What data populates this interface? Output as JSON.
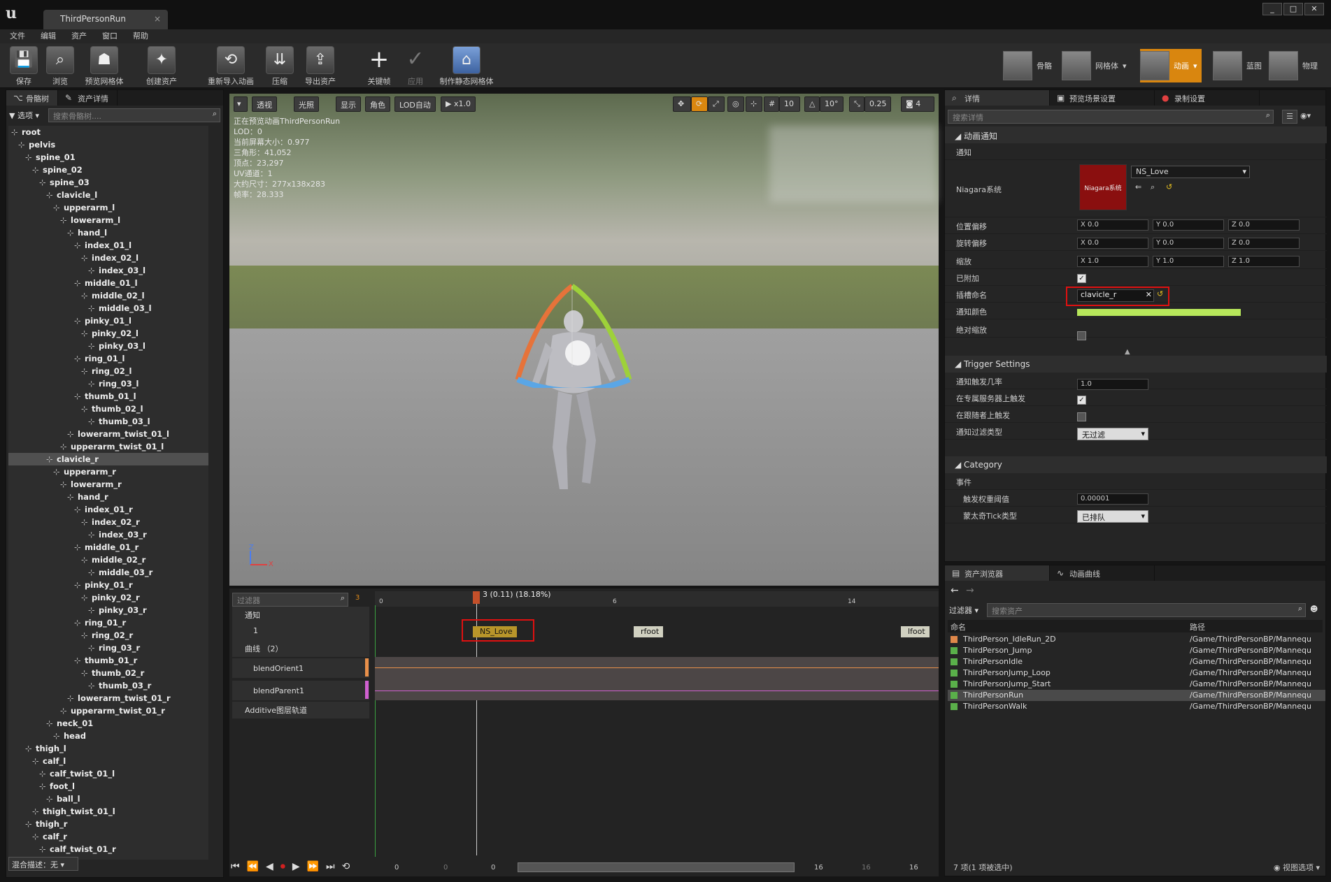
{
  "window": {
    "tab_title": "ThirdPersonRun",
    "buttons": [
      "_",
      "□",
      "✕"
    ]
  },
  "menu": [
    "文件",
    "编辑",
    "资产",
    "窗口",
    "帮助"
  ],
  "toolbar": {
    "items": [
      "保存",
      "浏览",
      "预览网格体",
      "创建资产",
      "重新导入动画",
      "压缩",
      "导出资产",
      "关键帧",
      "应用",
      "制作静态网格体"
    ],
    "modes": [
      "骨骼",
      "网格体",
      "动画",
      "蓝图",
      "物理"
    ],
    "active_mode": "动画"
  },
  "skeleton_panel": {
    "tabs": [
      "骨骼树",
      "资产详情"
    ],
    "options_label": "选项",
    "search_placeholder": "搜索骨骼树....",
    "bones": [
      "root",
      "pelvis",
      "spine_01",
      "spine_02",
      "spine_03",
      "clavicle_l",
      "upperarm_l",
      "lowerarm_l",
      "hand_l",
      "index_01_l",
      "index_02_l",
      "index_03_l",
      "middle_01_l",
      "middle_02_l",
      "middle_03_l",
      "pinky_01_l",
      "pinky_02_l",
      "pinky_03_l",
      "ring_01_l",
      "ring_02_l",
      "ring_03_l",
      "thumb_01_l",
      "thumb_02_l",
      "thumb_03_l",
      "lowerarm_twist_01_l",
      "upperarm_twist_01_l",
      "clavicle_r",
      "upperarm_r",
      "lowerarm_r",
      "hand_r",
      "index_01_r",
      "index_02_r",
      "index_03_r",
      "middle_01_r",
      "middle_02_r",
      "middle_03_r",
      "pinky_01_r",
      "pinky_02_r",
      "pinky_03_r",
      "ring_01_r",
      "ring_02_r",
      "ring_03_r",
      "thumb_01_r",
      "thumb_02_r",
      "thumb_03_r",
      "lowerarm_twist_01_r",
      "upperarm_twist_01_r",
      "neck_01",
      "head",
      "thigh_l",
      "calf_l",
      "calf_twist_01_l",
      "foot_l",
      "ball_l",
      "thigh_twist_01_l",
      "thigh_r",
      "calf_r",
      "calf_twist_01_r"
    ],
    "indent": [
      0,
      1,
      2,
      3,
      4,
      5,
      6,
      7,
      8,
      9,
      10,
      11,
      9,
      10,
      11,
      9,
      10,
      11,
      9,
      10,
      11,
      9,
      10,
      11,
      8,
      7,
      5,
      6,
      7,
      8,
      9,
      10,
      11,
      9,
      10,
      11,
      9,
      10,
      11,
      9,
      10,
      11,
      9,
      10,
      11,
      8,
      7,
      5,
      6,
      2,
      3,
      4,
      4,
      5,
      3,
      2,
      3,
      4
    ],
    "selected": "clavicle_r",
    "footer": "混合描述：无"
  },
  "viewport": {
    "buttons": [
      "透视",
      "光照",
      "显示",
      "角色",
      "LOD自动",
      "x1.0"
    ],
    "right_buttons": [
      "10",
      "10°",
      "0.25",
      "4"
    ],
    "info": [
      "正在预览动画ThirdPersonRun",
      "LOD：0",
      "当前屏幕大小：0.977",
      "三角形：41,052",
      "顶点：23,297",
      "UV通道：1",
      "大约尺寸：277x138x283",
      "帧率：28.333"
    ],
    "axis_z": "Z",
    "axis_x": "X"
  },
  "details": {
    "tabs": [
      "详情",
      "预览场景设置",
      "录制设置"
    ],
    "search_placeholder": "搜索详情",
    "sec_notify": "动画通知",
    "notify_label": "通知",
    "niagara_label": "Niagara系统",
    "niagara_thumb": "Niagara系统",
    "niagara_value": "NS_Love",
    "pos_label": "位置偏移",
    "rot_label": "旋转偏移",
    "scale_label": "缩放",
    "pos": [
      "X",
      "0.0",
      "Y",
      "0.0",
      "Z",
      "0.0"
    ],
    "rot": [
      "X",
      "0.0",
      "Y",
      "0.0",
      "Z",
      "0.0"
    ],
    "scale": [
      "X",
      "1.0",
      "Y",
      "1.0",
      "Z",
      "1.0"
    ],
    "attached_label": "已附加",
    "socket_label": "插槽命名",
    "socket_value": "clavicle_r",
    "color_label": "通知颜色",
    "color_value": "#b6e65a",
    "abs_scale_label": "绝对缩放",
    "sec_trigger": "Trigger Settings",
    "chance_label": "通知触发几率",
    "chance_value": "1.0",
    "dedicated_label": "在专属服务器上触发",
    "follower_label": "在跟随者上触发",
    "filter_label": "通知过滤类型",
    "filter_value": "无过滤",
    "sec_category": "Category",
    "event_label": "事件",
    "weight_label": "触发权重阈值",
    "weight_value": "0.00001",
    "montage_label": "蒙太奇Tick类型",
    "montage_value": "已排队"
  },
  "assets": {
    "tabs": [
      "资产浏览器",
      "动画曲线"
    ],
    "filter_label": "过滤器",
    "search_placeholder": "搜索资产",
    "col_name": "命名",
    "col_path": "路径",
    "rows": [
      {
        "name": "ThirdPerson_IdleRun_2D",
        "path": "/Game/ThirdPersonBP/Mannequ"
      },
      {
        "name": "ThirdPerson_Jump",
        "path": "/Game/ThirdPersonBP/Mannequ"
      },
      {
        "name": "ThirdPersonIdle",
        "path": "/Game/ThirdPersonBP/Mannequ"
      },
      {
        "name": "ThirdPersonJump_Loop",
        "path": "/Game/ThirdPersonBP/Mannequ"
      },
      {
        "name": "ThirdPersonJump_Start",
        "path": "/Game/ThirdPersonBP/Mannequ"
      },
      {
        "name": "ThirdPersonRun",
        "path": "/Game/ThirdPersonBP/Mannequ"
      },
      {
        "name": "ThirdPersonWalk",
        "path": "/Game/ThirdPersonBP/Mannequ"
      }
    ],
    "selected": "ThirdPersonRun",
    "status": "7 项(1 项被选中)",
    "view_options": "视图选项"
  },
  "timeline": {
    "filter_placeholder": "过滤器",
    "frame_badge": "3",
    "playhead": "3 (0.11) (18.18%)",
    "ticks": [
      "0",
      "6",
      "14"
    ],
    "tracks": {
      "notify": "通知",
      "notify_row": "1",
      "curves": "曲线 （2）",
      "curve1": "blendOrient1",
      "curve2": "blendParent1",
      "additive": "Additive图层轨道"
    },
    "notifies": [
      "NS_Love",
      "rfoot",
      "lfoot"
    ],
    "bottom_numbers": [
      "0",
      "0",
      "0",
      "16",
      "16",
      "16"
    ]
  }
}
